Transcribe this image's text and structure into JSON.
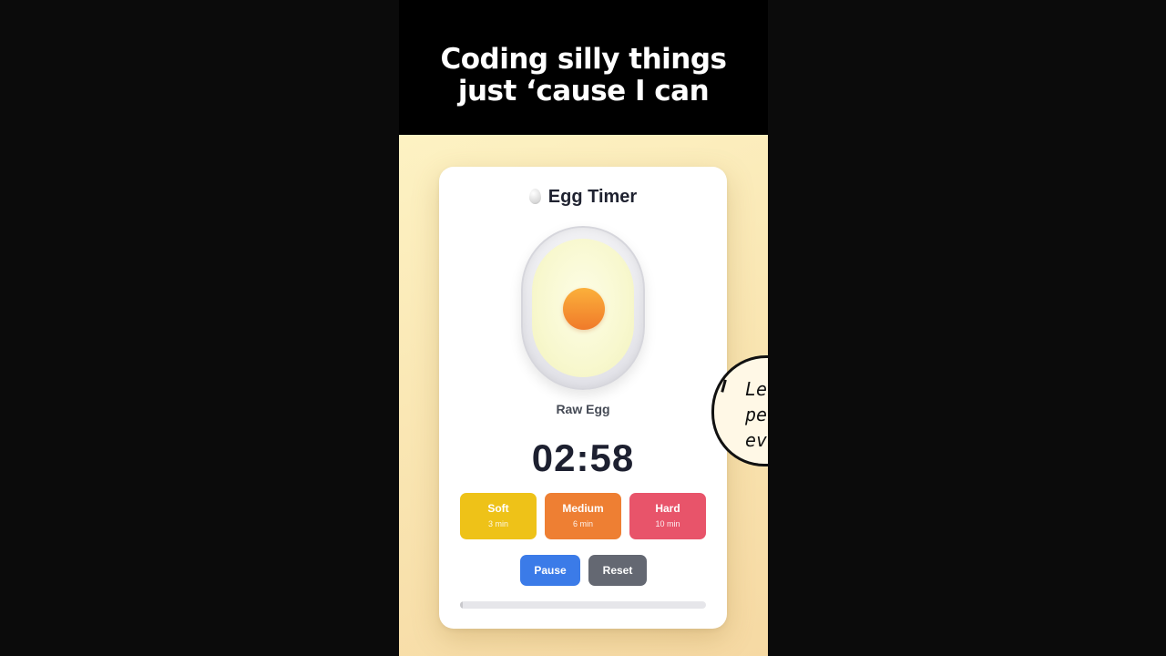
{
  "caption": {
    "line1": "Coding silly things",
    "line2": "just ‘cause I can"
  },
  "app": {
    "title": "Egg Timer",
    "title_icon": "egg-icon",
    "egg_state": "Raw Egg",
    "timer": "02:58",
    "presets": [
      {
        "label": "Soft",
        "time": "3 min",
        "color": "#eec218"
      },
      {
        "label": "Medium",
        "time": "6 min",
        "color": "#ee7f33"
      },
      {
        "label": "Hard",
        "time": "10 min",
        "color": "#e8546a"
      }
    ],
    "controls": {
      "pause_label": "Pause",
      "reset_label": "Reset"
    },
    "progress_percent": 1
  },
  "speech_bubble": {
    "text": "Let\npe\nev"
  },
  "colors": {
    "accent_blue": "#3b7be8",
    "neutral_gray": "#646872",
    "background_cream": "#fdf2c3"
  }
}
